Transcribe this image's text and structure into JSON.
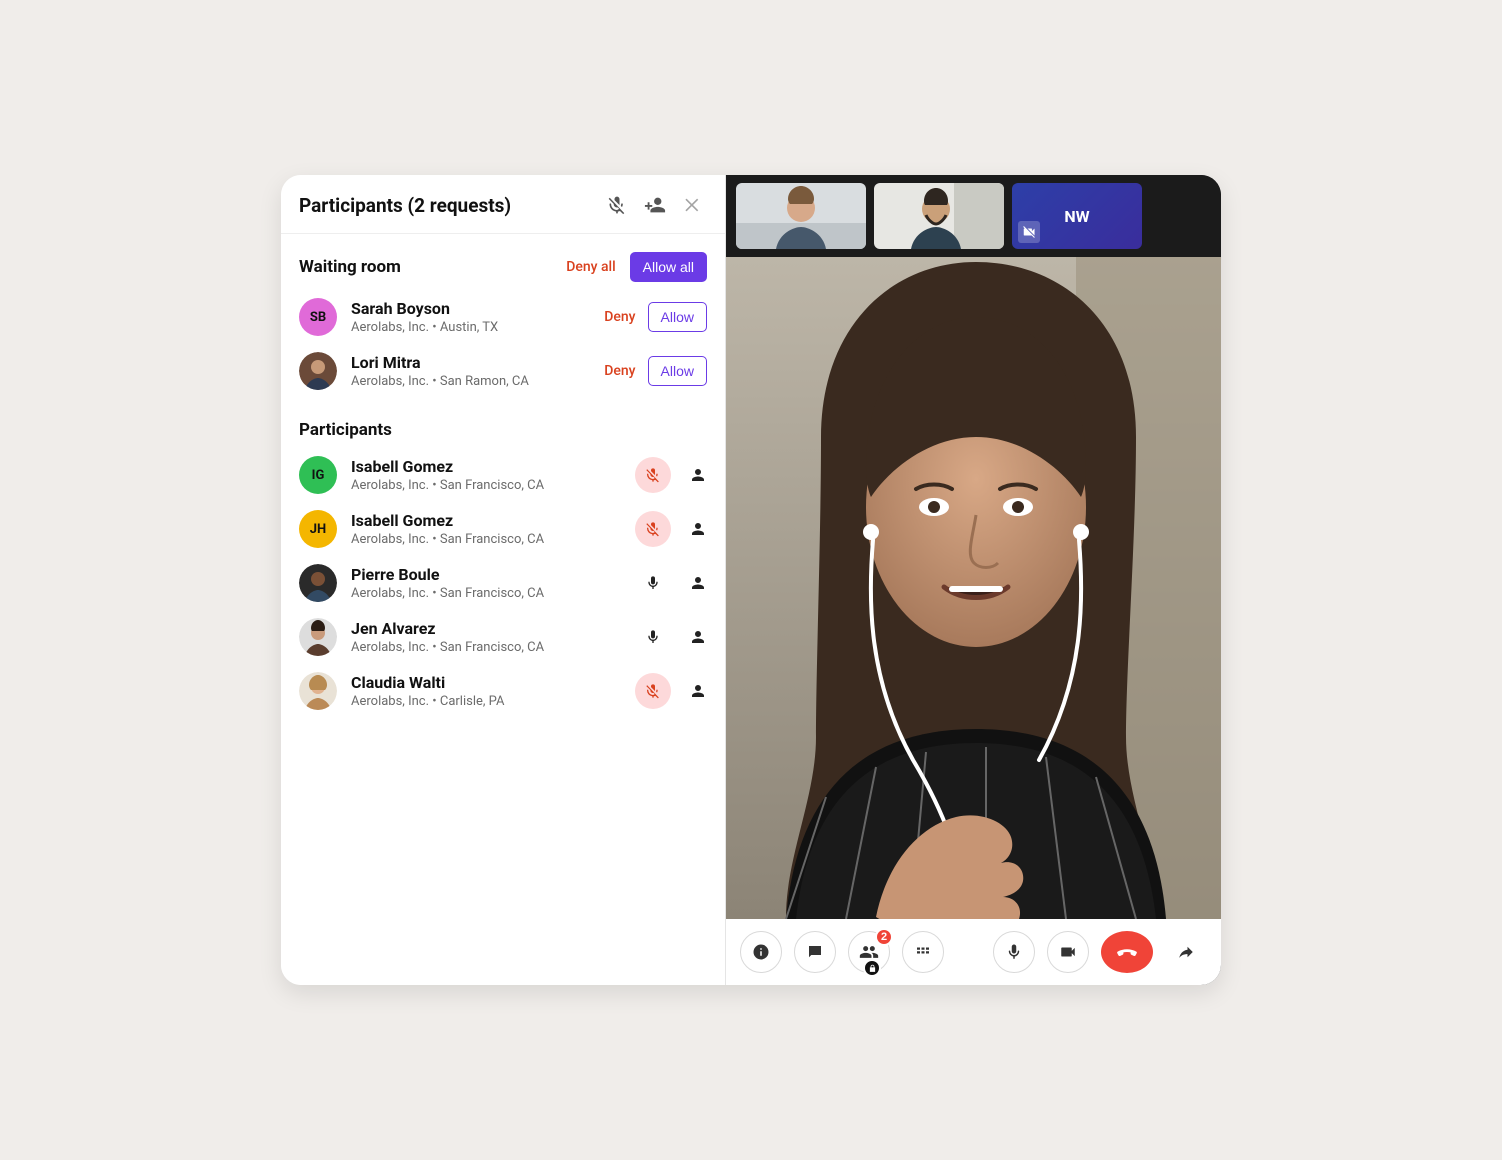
{
  "panel": {
    "title": "Participants (2 requests)",
    "waiting_room_title": "Waiting room",
    "deny_all": "Deny all",
    "allow_all": "Allow all",
    "participants_title": "Participants",
    "row_deny": "Deny",
    "row_allow": "Allow"
  },
  "waiting": [
    {
      "name": "Sarah Boyson",
      "sub": "Aerolabs, Inc.  •  Austin, TX",
      "initials": "SB",
      "avatar_bg": "#e06ad8"
    },
    {
      "name": "Lori Mitra",
      "sub": "Aerolabs, Inc.  •  San Ramon, CA",
      "initials": "",
      "avatar_bg": "photo"
    }
  ],
  "participants": [
    {
      "name": "Isabell Gomez",
      "sub": "Aerolabs, Inc.  •  San Francisco, CA",
      "initials": "IG",
      "avatar_bg": "#2fbf55",
      "muted": true
    },
    {
      "name": "Isabell Gomez",
      "sub": "Aerolabs, Inc.  •  San Francisco, CA",
      "initials": "JH",
      "avatar_bg": "#f4b600",
      "muted": true
    },
    {
      "name": "Pierre Boule",
      "sub": "Aerolabs, Inc.  •  San Francisco, CA",
      "initials": "",
      "avatar_bg": "photo",
      "muted": false
    },
    {
      "name": "Jen Alvarez",
      "sub": "Aerolabs, Inc.  •  San Francisco, CA",
      "initials": "",
      "avatar_bg": "photo",
      "muted": false
    },
    {
      "name": "Claudia Walti",
      "sub": "Aerolabs, Inc.  •  Carlisle, PA",
      "initials": "",
      "avatar_bg": "photo",
      "muted": true
    }
  ],
  "thumbnails": [
    {
      "kind": "video"
    },
    {
      "kind": "video"
    },
    {
      "kind": "avatar",
      "initials": "NW",
      "camera_off": true
    }
  ],
  "controls": {
    "participants_badge": "2"
  }
}
